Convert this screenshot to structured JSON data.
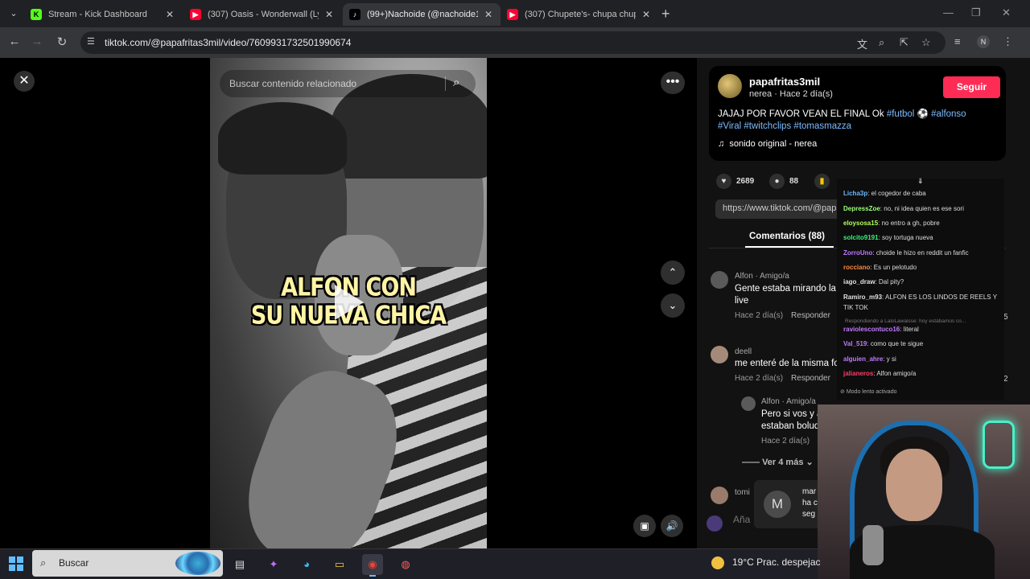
{
  "browser": {
    "tabs": [
      {
        "title": "Stream - Kick Dashboard",
        "favicon": "kick-icon",
        "color": "#53fc18",
        "active": false
      },
      {
        "title": "(307) Oasis - Wonderwall (Lyric",
        "favicon": "youtube-icon",
        "color": "#ff0033",
        "active": false
      },
      {
        "title": "(99+)Nachoide (@nachoide1) |",
        "favicon": "tiktok-icon",
        "color": "#ffffff",
        "active": true
      },
      {
        "title": "(307) Chupete's- chupa chupa c",
        "favicon": "youtube-icon",
        "color": "#ff0033",
        "active": false
      }
    ],
    "url": "tiktok.com/@papafritas3mil/video/7609931732501990674",
    "profile_initial": "N"
  },
  "video": {
    "search_placeholder": "Buscar contenido relacionado",
    "caption_line1": "ALFON CON",
    "caption_line2": "SU NUEVA CHICA"
  },
  "post": {
    "author": "papafritas3mil",
    "subtitle": "nerea · Hace 2 día(s)",
    "follow_label": "Seguir",
    "desc_text1": "JAJAJ POR FAVOR VEAN EL FINAL Ok ",
    "tag_futbol": "#futbol",
    "ball": "⚽",
    "tag_alfonso": "#alfonso",
    "tag_viral": "#Viral",
    "tag_twitchclips": "#twitchclips",
    "tag_tomasmazza": "#tomasmazza",
    "sound": "sonido original - nerea",
    "likes": "2689",
    "comments_count": "88",
    "share_link": "https://www.tiktok.com/@papafritas3mil/video/7609931732501990674",
    "comments_tab": "Comentarios (88)"
  },
  "comments": [
    {
      "name": "Alfon · Amigo/a",
      "line1": "Gente estaba mirando la",
      "line2": "live",
      "meta": "Hace 2 día(s)",
      "reply": "Responder"
    },
    {
      "name": "deell",
      "line1": "me enteré de la misma fo",
      "line2": "",
      "meta": "Hace 2 día(s)",
      "reply": "Responder"
    },
    {
      "name": "Alfon · Amigo/a",
      "line1": "Pero si vos y a",
      "line2": "estaban bolud",
      "meta": "Hace 2 día(s)",
      "reply": "R"
    },
    {
      "name": "tomi",
      "line1": "",
      "line2": "",
      "meta": "",
      "reply": ""
    }
  ],
  "ver_mas": "Ver 4 más",
  "add_comment": "Aña",
  "toast": {
    "avatar": "M",
    "line1": "mar",
    "line2": "ha c",
    "line3": "seg"
  },
  "side_counts": {
    "a": "5",
    "b": "2"
  },
  "chat": {
    "messages": [
      {
        "user": "Licha3p",
        "color": "#6ab7ff",
        "text": ": el cogedor de caba"
      },
      {
        "user": "DepressZoe",
        "color": "#9cff7a",
        "text": ": no, ni idea quien es ese sori"
      },
      {
        "user": "eloysosa15",
        "color": "#b5ff5a",
        "text": ": no entro a gh, pobre"
      },
      {
        "user": "solcito9191",
        "color": "#3df07a",
        "text": ": soy tortuga nueva"
      },
      {
        "user": "ZorroUno",
        "color": "#c07aff",
        "text": ": choide le hizo en reddit un fanfic"
      },
      {
        "user": "rocciano",
        "color": "#ff8a3d",
        "text": ": Es un pelotudo"
      },
      {
        "user": "iago_draw",
        "color": "#e0e0e0",
        "text": ": Dal pity?"
      },
      {
        "user": "Ramiro_m93",
        "color": "#e0e0e0",
        "text": ": ALFON ES LOS LINDOS DE REELS Y"
      },
      {
        "user": "",
        "color": "#e0e0e0",
        "text": "TIK TOK"
      },
      {
        "user": "raviolescontuco16",
        "color": "#c07aff",
        "text": ": literal"
      },
      {
        "user": "Val_519",
        "color": "#c07aff",
        "text": ": como que te sigue"
      },
      {
        "user": "alguien_ahre",
        "color": "#c07aff",
        "text": ": y si"
      },
      {
        "user": "jalianeros",
        "color": "#ff3d6a",
        "text": ": Alfon amigo/a"
      }
    ],
    "reply_note": "Respondiendo a LaloLawaisse: hoy estábamos co...",
    "footer": "Modo lento activado"
  },
  "taskbar": {
    "search_label": "Buscar",
    "weather": "19°C  Prac. despejac"
  }
}
